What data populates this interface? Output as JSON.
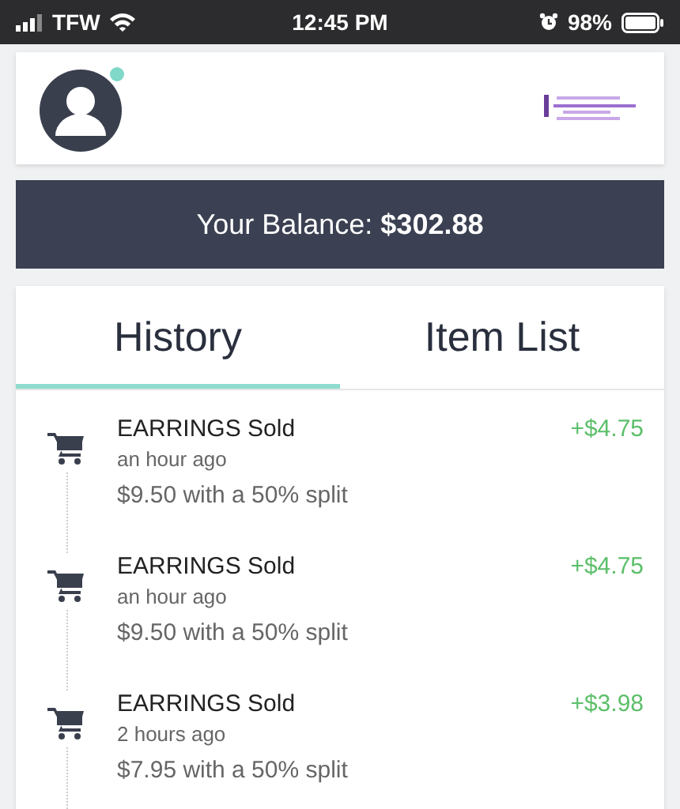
{
  "status_bar": {
    "carrier": "TFW",
    "time": "12:45 PM",
    "battery": "98%"
  },
  "balance": {
    "label": "Your Balance:",
    "amount": "$302.88"
  },
  "tabs": [
    {
      "label": "History",
      "selected": true
    },
    {
      "label": "Item List",
      "selected": false
    }
  ],
  "history": [
    {
      "title": "EARRINGS Sold",
      "time": "an hour ago",
      "detail": "$9.50 with a 50% split",
      "amount": "+$4.75"
    },
    {
      "title": "EARRINGS Sold",
      "time": "an hour ago",
      "detail": "$9.50 with a 50% split",
      "amount": "+$4.75"
    },
    {
      "title": "EARRINGS Sold",
      "time": "2 hours ago",
      "detail": "$7.95 with a 50% split",
      "amount": "+$3.98"
    }
  ]
}
